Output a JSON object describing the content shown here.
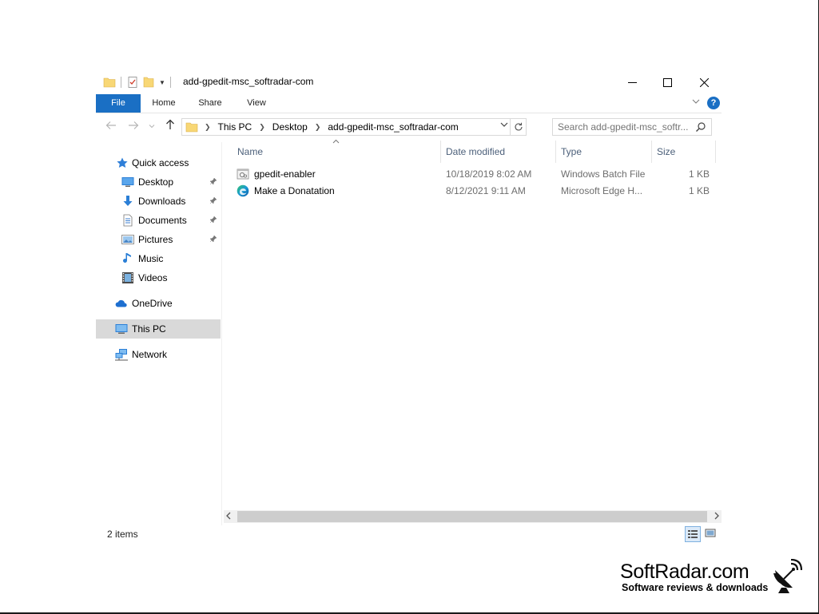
{
  "window": {
    "title": "add-gpedit-msc_softradar-com",
    "controls": {
      "minimize": "─",
      "maximize": "☐",
      "close": "✕"
    }
  },
  "ribbon": {
    "tabs": [
      {
        "label": "File",
        "active": true
      },
      {
        "label": "Home"
      },
      {
        "label": "Share"
      },
      {
        "label": "View"
      }
    ],
    "help": "?",
    "accent_color": "#1a6fc4"
  },
  "navigation": {
    "breadcrumbs": [
      "This PC",
      "Desktop",
      "add-gpedit-msc_softradar-com"
    ],
    "search_placeholder": "Search add-gpedit-msc_softr..."
  },
  "sidebar": {
    "items": [
      {
        "label": "Quick access",
        "icon": "star-icon"
      },
      {
        "label": "Desktop",
        "icon": "desktop-icon",
        "pinned": true
      },
      {
        "label": "Downloads",
        "icon": "download-icon",
        "pinned": true
      },
      {
        "label": "Documents",
        "icon": "document-icon",
        "pinned": true
      },
      {
        "label": "Pictures",
        "icon": "pictures-icon",
        "pinned": true
      },
      {
        "label": "Music",
        "icon": "music-icon"
      },
      {
        "label": "Videos",
        "icon": "video-icon"
      },
      {
        "label": "OneDrive",
        "icon": "cloud-icon"
      },
      {
        "label": "This PC",
        "icon": "computer-icon",
        "selected": true
      },
      {
        "label": "Network",
        "icon": "network-icon"
      }
    ]
  },
  "file_list": {
    "columns": [
      "Name",
      "Date modified",
      "Type",
      "Size"
    ],
    "rows": [
      {
        "name": "gpedit-enabler",
        "date": "10/18/2019 8:02 AM",
        "type": "Windows Batch File",
        "size": "1 KB",
        "icon": "batch-file-icon"
      },
      {
        "name": "Make a Donatation",
        "date": "8/12/2021 9:11 AM",
        "type": "Microsoft Edge H...",
        "size": "1 KB",
        "icon": "edge-icon"
      }
    ]
  },
  "status": {
    "item_count": "2 items"
  },
  "watermark": {
    "name": "SoftRadar.com",
    "tagline": "Software reviews & downloads"
  }
}
